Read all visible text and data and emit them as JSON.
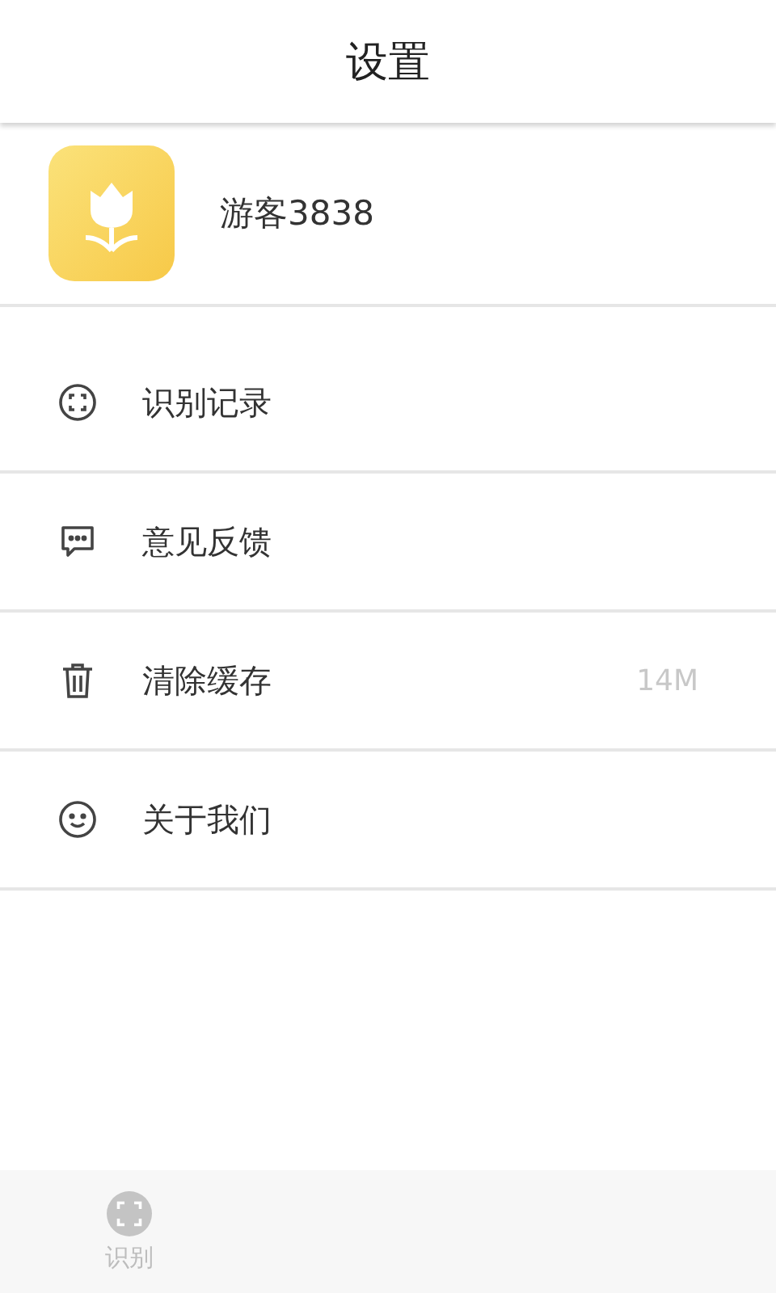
{
  "header": {
    "title": "设置"
  },
  "profile": {
    "name": "游客3838"
  },
  "menu": [
    {
      "kind": "scan",
      "label": "识别记录"
    },
    {
      "kind": "chat",
      "label": "意见反馈"
    },
    {
      "kind": "trash",
      "label": "清除缓存",
      "value": "14M"
    },
    {
      "kind": "smile",
      "label": "关于我们"
    }
  ],
  "tab_bar": {
    "tabs": [
      {
        "kind": "scan",
        "label": "识别",
        "selected": false
      }
    ]
  }
}
